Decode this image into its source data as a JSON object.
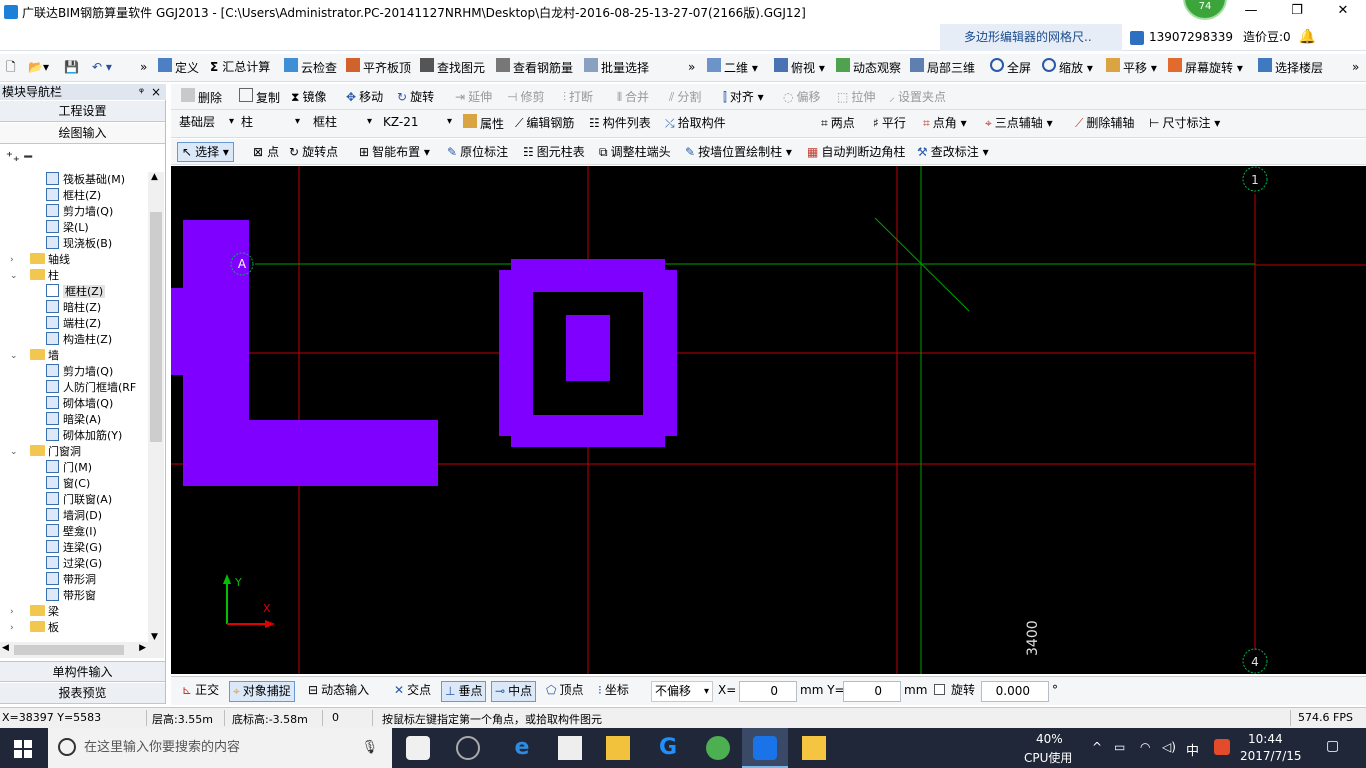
{
  "window": {
    "title": "广联达BIM钢筋算量软件 GGJ2013 - [C:\\Users\\Administrator.PC-20141127NRHM\\Desktop\\白龙村-2016-08-25-13-27-07(2166版).GGJ12]",
    "perf_badge": "74",
    "minimize": "—",
    "restore": "❐",
    "close": "✕"
  },
  "infobar": {
    "hint": "多边形编辑器的网格尺..",
    "phone": "13907298339",
    "cost_bean": "造价豆:0"
  },
  "toolbar1": {
    "items": [
      "定义",
      "汇总计算",
      "云检查",
      "平齐板顶",
      "查找图元",
      "查看钢筋量",
      "批量选择",
      "二维",
      "俯视",
      "动态观察",
      "局部三维",
      "全屏",
      "缩放",
      "平移",
      "屏幕旋转",
      "选择楼层"
    ]
  },
  "toolbar2": {
    "items": [
      "删除",
      "复制",
      "镜像",
      "移动",
      "旋转",
      "延伸",
      "修剪",
      "打断",
      "合并",
      "分割",
      "对齐",
      "偏移",
      "拉伸",
      "设置夹点"
    ]
  },
  "toolbar3": {
    "floor": "基础层",
    "category": "柱",
    "type": "框柱",
    "component": "KZ-21",
    "items": [
      "属性",
      "编辑钢筋",
      "构件列表",
      "拾取构件"
    ],
    "axis_items": [
      "两点",
      "平行",
      "点角",
      "三点辅轴",
      "删除辅轴",
      "尺寸标注"
    ]
  },
  "toolbar4": {
    "items": [
      "选择",
      "点",
      "旋转点",
      "智能布置",
      "原位标注",
      "图元柱表",
      "调整柱端头",
      "按墙位置绘制柱",
      "自动判断边角柱",
      "查改标注"
    ]
  },
  "nav": {
    "header": "模块导航栏",
    "pin": "ᵠ",
    "close": "×",
    "tab_project": "工程设置",
    "tab_draw": "绘图输入",
    "tab_single": "单构件输入",
    "tab_report": "报表预览",
    "tree": [
      {
        "label": "筏板基础(M)",
        "level": 3,
        "type": "leaf"
      },
      {
        "label": "框柱(Z)",
        "level": 3,
        "type": "leaf"
      },
      {
        "label": "剪力墙(Q)",
        "level": 3,
        "type": "leaf"
      },
      {
        "label": "梁(L)",
        "level": 3,
        "type": "leaf"
      },
      {
        "label": "现浇板(B)",
        "level": 3,
        "type": "leaf"
      },
      {
        "label": "轴线",
        "level": 1,
        "type": "folder",
        "state": "closed"
      },
      {
        "label": "柱",
        "level": 1,
        "type": "folder",
        "state": "open"
      },
      {
        "label": "框柱(Z)",
        "level": 2,
        "type": "leaf",
        "selected": true
      },
      {
        "label": "暗柱(Z)",
        "level": 2,
        "type": "leaf"
      },
      {
        "label": "端柱(Z)",
        "level": 2,
        "type": "leaf"
      },
      {
        "label": "构造柱(Z)",
        "level": 2,
        "type": "leaf"
      },
      {
        "label": "墙",
        "level": 1,
        "type": "folder",
        "state": "open"
      },
      {
        "label": "剪力墙(Q)",
        "level": 2,
        "type": "leaf"
      },
      {
        "label": "人防门框墙(RF",
        "level": 2,
        "type": "leaf"
      },
      {
        "label": "砌体墙(Q)",
        "level": 2,
        "type": "leaf"
      },
      {
        "label": "暗梁(A)",
        "level": 2,
        "type": "leaf"
      },
      {
        "label": "砌体加筋(Y)",
        "level": 2,
        "type": "leaf"
      },
      {
        "label": "门窗洞",
        "level": 1,
        "type": "folder",
        "state": "open"
      },
      {
        "label": "门(M)",
        "level": 2,
        "type": "leaf"
      },
      {
        "label": "窗(C)",
        "level": 2,
        "type": "leaf"
      },
      {
        "label": "门联窗(A)",
        "level": 2,
        "type": "leaf"
      },
      {
        "label": "墙洞(D)",
        "level": 2,
        "type": "leaf"
      },
      {
        "label": "壁龛(I)",
        "level": 2,
        "type": "leaf"
      },
      {
        "label": "连梁(G)",
        "level": 2,
        "type": "leaf"
      },
      {
        "label": "过梁(G)",
        "level": 2,
        "type": "leaf"
      },
      {
        "label": "带形洞",
        "level": 2,
        "type": "leaf"
      },
      {
        "label": "带形窗",
        "level": 2,
        "type": "leaf"
      },
      {
        "label": "梁",
        "level": 1,
        "type": "folder",
        "state": "closed"
      },
      {
        "label": "板",
        "level": 1,
        "type": "folder",
        "state": "closed"
      }
    ]
  },
  "canvas": {
    "axis_a": "A",
    "axis_1": "1",
    "axis_4": "4",
    "dimension": "3400",
    "ucs_y": "Y",
    "ucs_x": "X",
    "colors": {
      "background": "#000000",
      "column": "#8000ff",
      "axis_red": "#c00000",
      "axis_green": "#00a000",
      "bubble": "#00b050"
    }
  },
  "snapbar": {
    "ortho": "正交",
    "snap": "对象捕捉",
    "dyn": "动态输入",
    "intersect": "交点",
    "perp": "垂点",
    "mid": "中点",
    "vertex": "顶点",
    "coord": "坐标",
    "offset_mode": "不偏移",
    "x_label": "X=",
    "x_value": "0",
    "y_label": "mm Y=",
    "y_value": "0",
    "unit": "mm",
    "rotate": "旋转",
    "rotate_value": "0.000",
    "deg": "°"
  },
  "status": {
    "coords": "X=38397 Y=5583",
    "floor_height": "层高:3.55m",
    "bottom_elev": "底标高:-3.58m",
    "zero": "0",
    "prompt": "按鼠标左键指定第一个角点，或拾取构件图元",
    "fps": "574.6 FPS"
  },
  "taskbar": {
    "search_placeholder": "在这里输入你要搜索的内容",
    "cpu_percent": "40%",
    "cpu_label": "CPU使用",
    "ime": "中",
    "time": "10:44",
    "date": "2017/7/15"
  }
}
